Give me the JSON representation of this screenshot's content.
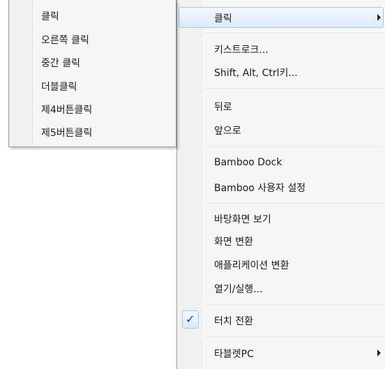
{
  "context_menu": {
    "items": [
      {
        "label": "클릭",
        "submenu": true,
        "highlighted": true
      },
      {
        "label": "키스트로크..."
      },
      {
        "label": "Shift, Alt, Ctrl키..."
      },
      {
        "label": "뒤로"
      },
      {
        "label": "앞으로"
      },
      {
        "label": "Bamboo Dock"
      },
      {
        "label": "Bamboo 사용자 설정"
      },
      {
        "label": "바탕화면 보기"
      },
      {
        "label": "화면 변환"
      },
      {
        "label": "애플리케이션 변환"
      },
      {
        "label": "열기/실행..."
      },
      {
        "label": "터치 전환",
        "checked": true
      },
      {
        "label": "타블렛PC",
        "submenu": true
      }
    ],
    "check_glyph": "✓"
  },
  "click_submenu": {
    "items": [
      {
        "label": "클릭"
      },
      {
        "label": "오른쪽 클릭"
      },
      {
        "label": "중간 클릭"
      },
      {
        "label": "더블클릭"
      },
      {
        "label": "제4버튼클릭"
      },
      {
        "label": "제5버튼클릭"
      }
    ]
  },
  "colors": {
    "highlight_border": "#a9c6ea",
    "menu_background": "#f6f6f6",
    "check": "#1e3d6e"
  }
}
